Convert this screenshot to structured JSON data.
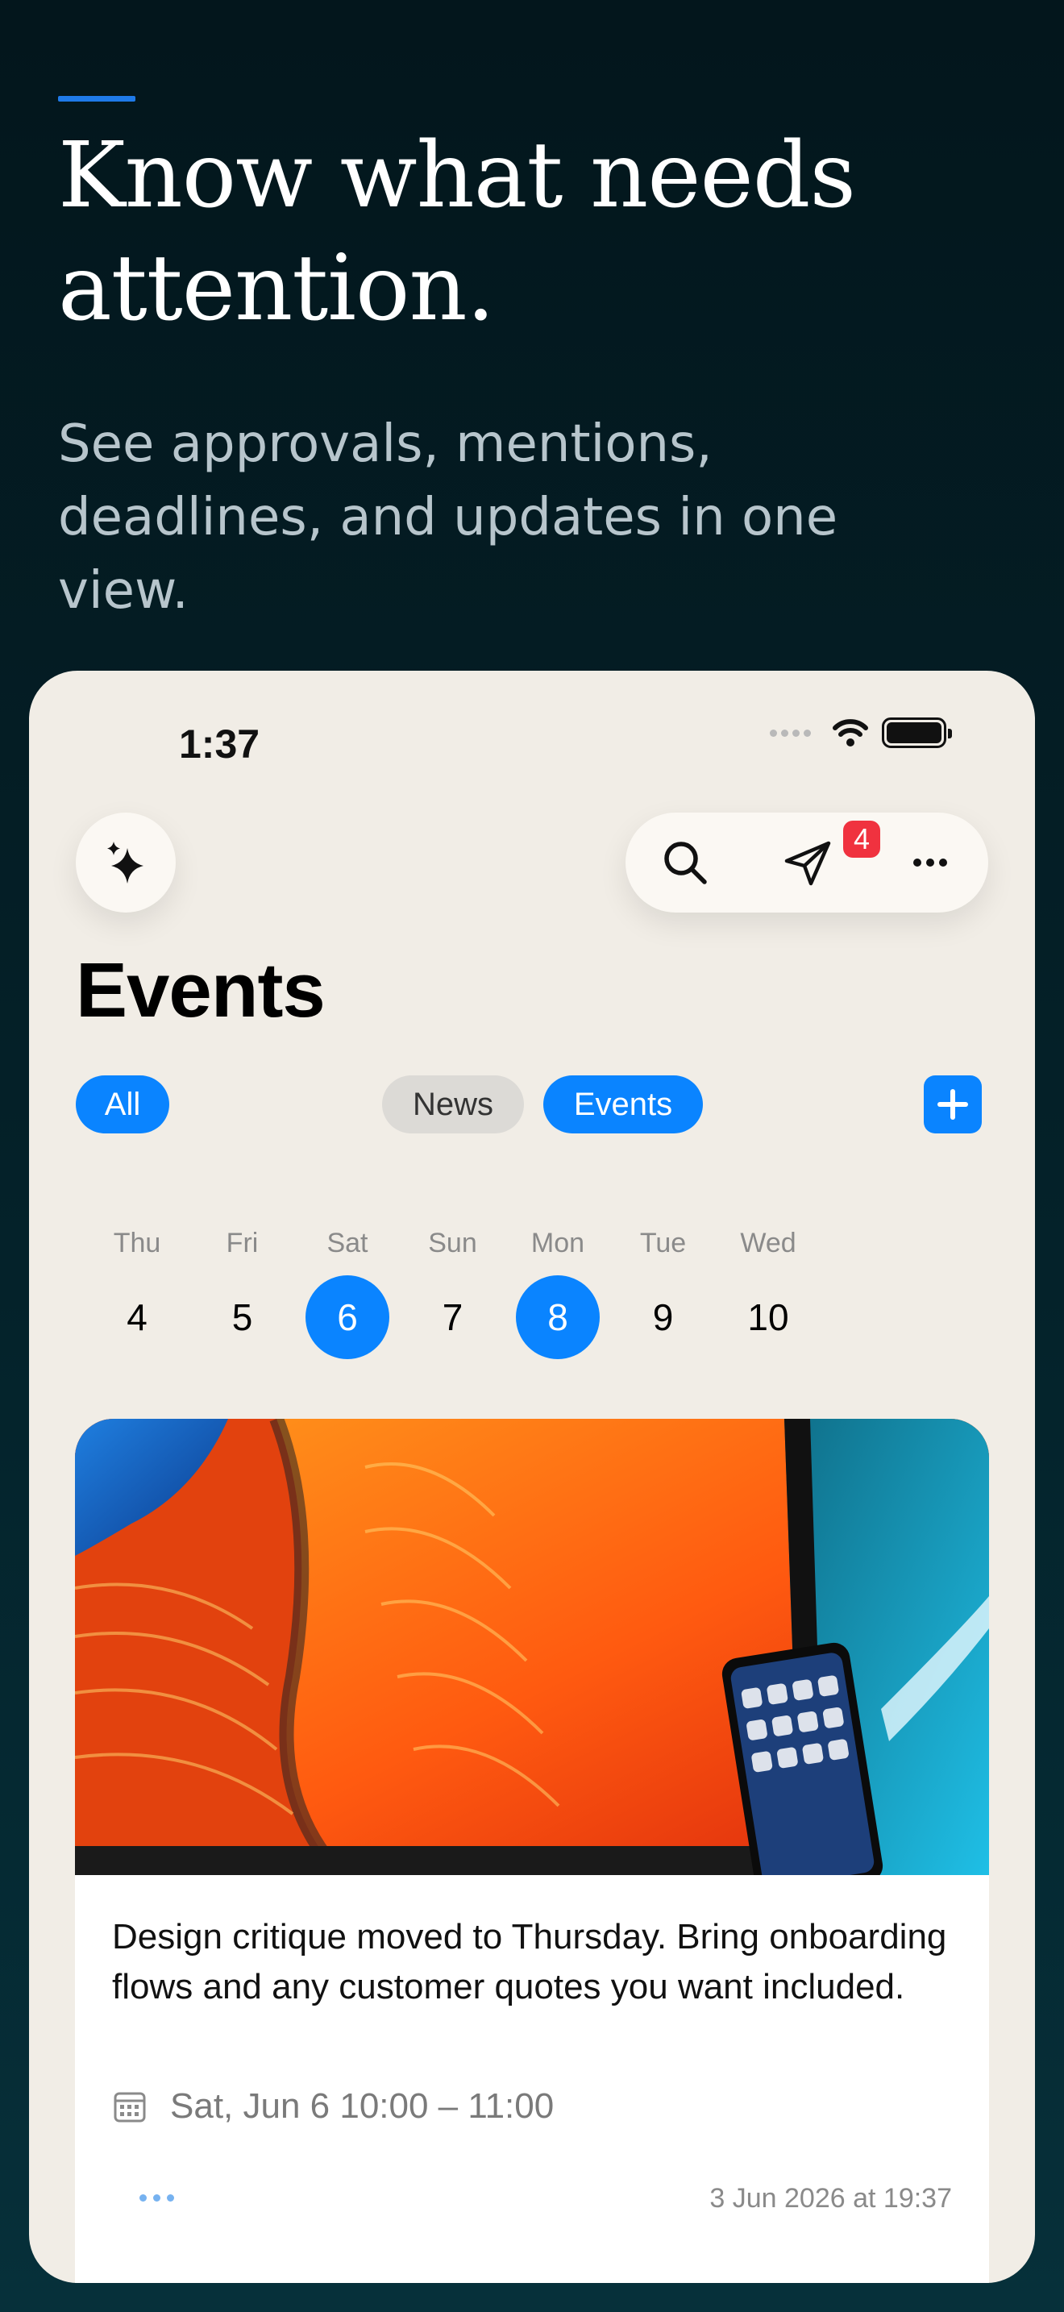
{
  "hero": {
    "headline": "Know what needs attention.",
    "subhead": "See approvals, mentions, deadlines, and updates in one view."
  },
  "status_bar": {
    "time": "1:37",
    "icons": [
      "signal-icon",
      "wifi-icon",
      "battery-icon"
    ]
  },
  "toolbar": {
    "ai_icon": "sparkles-icon",
    "actions": [
      "search-icon",
      "send-icon",
      "more-icon"
    ],
    "notification_count": "4"
  },
  "page": {
    "title": "Events"
  },
  "filters": {
    "all": "All",
    "news": "News",
    "events": "Events",
    "add_icon": "plus-icon"
  },
  "week": {
    "days": [
      {
        "name": "Thu",
        "date": "4",
        "selected": false
      },
      {
        "name": "Fri",
        "date": "5",
        "selected": false
      },
      {
        "name": "Sat",
        "date": "6",
        "selected": true
      },
      {
        "name": "Sun",
        "date": "7",
        "selected": false
      },
      {
        "name": "Mon",
        "date": "8",
        "selected": true
      },
      {
        "name": "Tue",
        "date": "9",
        "selected": false
      },
      {
        "name": "Wed",
        "date": "10",
        "selected": false
      }
    ]
  },
  "card": {
    "text": "Design critique moved to Thursday. Bring onboarding flows and any customer quotes you want included.",
    "date": "Sat, Jun 6 10:00 – 11:00",
    "timestamp": "3 Jun 2026 at 19:37"
  },
  "colors": {
    "accent": "#0a84ff",
    "badge": "#f0323f",
    "background": "#03161c",
    "phone": "#f1ede6"
  }
}
